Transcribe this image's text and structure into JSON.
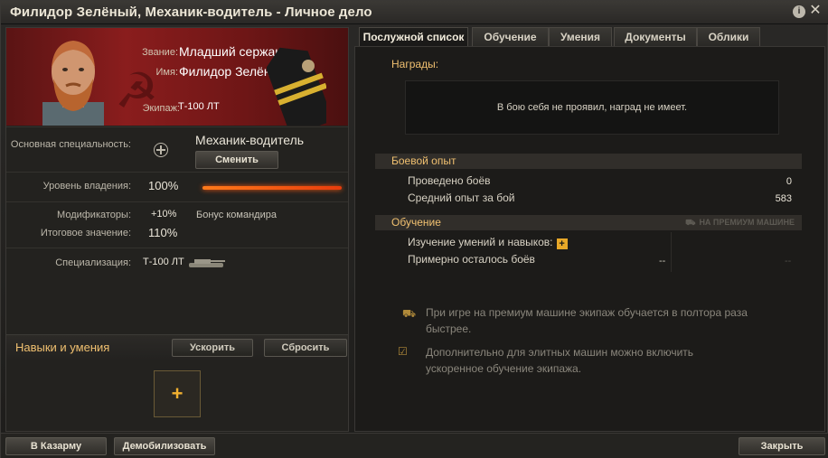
{
  "window": {
    "title": "Филидор Зелёный, Механик-водитель - Личное дело"
  },
  "header_icons": [
    "info-icon",
    "close-icon"
  ],
  "profile": {
    "rank_label": "Звание:",
    "rank_value": "Младший сержант",
    "name_label": "Имя:",
    "name_value": "Филидор Зелёный",
    "crew_label": "Экипаж:",
    "crew_value": "Т-100 ЛТ"
  },
  "specialty": {
    "label": "Основная специальность:",
    "value": "Механик-водитель",
    "change_button": "Сменить"
  },
  "proficiency": {
    "label": "Уровень владения:",
    "value": "100%",
    "level": 1.0
  },
  "modifiers": {
    "label": "Модификаторы:",
    "value": "+10%",
    "bonus": "Бонус командира",
    "total_label": "Итоговое значение:",
    "total_value": "110%"
  },
  "specialization": {
    "label": "Специализация:",
    "value": "Т-100 ЛТ"
  },
  "skills": {
    "title": "Навыки и умения",
    "accelerate_button": "Ускорить",
    "reset_button": "Сбросить",
    "add_symbol": "+"
  },
  "tabs": [
    {
      "label": "Послужной список",
      "active": true
    },
    {
      "label": "Обучение",
      "active": false
    },
    {
      "label": "Умения",
      "active": false
    },
    {
      "label": "Документы",
      "active": false
    },
    {
      "label": "Облики",
      "active": false
    }
  ],
  "awards": {
    "title": "Награды:",
    "empty_text": "В бою себя не проявил, наград не имеет."
  },
  "combat": {
    "title": "Боевой опыт",
    "rows": [
      {
        "label": "Проведено боёв",
        "value": "0"
      },
      {
        "label": "Средний опыт за бой",
        "value": "583"
      }
    ]
  },
  "training": {
    "title": "Обучение",
    "premium_label": "НА ПРЕМИУМ МАШИНЕ",
    "skills_label": "Изучение умений и навыков:",
    "battles_label": "Примерно осталось боёв",
    "battles_value": "--",
    "battles_premium_value": "--",
    "note_premium": "При игре на премиум машине экипаж обучается в полтора раза быстрее.",
    "note_elite": "Дополнительно для элитных машин можно включить ускоренное обучение экипажа."
  },
  "footer": {
    "barracks_button": "В Казарму",
    "demobilize_button": "Демобилизовать",
    "close_button": "Закрыть"
  },
  "colors": {
    "accent": "#f0c070",
    "bar": "#ff6a14",
    "banner": "#7a1a1a"
  }
}
